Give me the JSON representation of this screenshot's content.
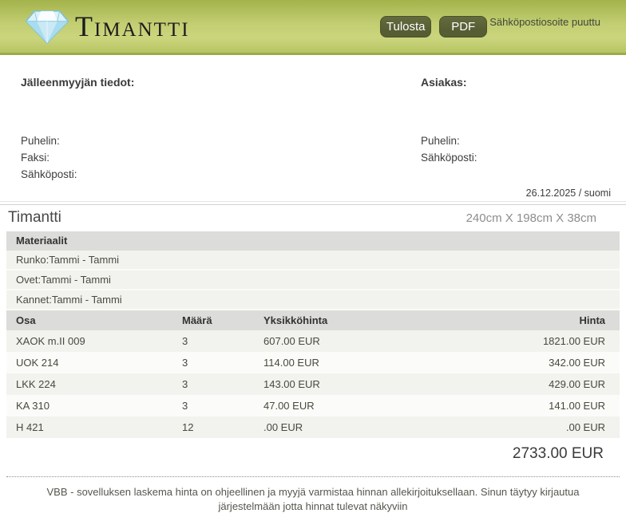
{
  "header": {
    "brand": "Timantti",
    "print_button": "Tulosta",
    "pdf_button": "PDF",
    "email_warning": "Sähköpostiosoite puuttu"
  },
  "info": {
    "dealer_heading": "Jälleenmyyjän tiedot:",
    "customer_heading": "Asiakas:",
    "dealer_fields": [
      "Puhelin:",
      "Faksi:",
      "Sähköposti:"
    ],
    "customer_fields": [
      "Puhelin:",
      "Sähköposti:"
    ],
    "date_line": "26.12.2025 / suomi"
  },
  "quote": {
    "title": "Timantti",
    "dimensions": "240cm X 198cm X 38cm",
    "materials_heading": "Materiaalit",
    "materials": [
      "Runko:Tammi - Tammi",
      "Ovet:Tammi - Tammi",
      "Kannet:Tammi - Tammi"
    ],
    "parts_table": {
      "headers": [
        "Osa",
        "Määrä",
        "Yksikköhinta",
        "Hinta"
      ],
      "rows": [
        [
          "XAOK m.II 009",
          "3",
          "607.00 EUR",
          "1821.00 EUR"
        ],
        [
          "UOK 214",
          "3",
          "114.00 EUR",
          "342.00 EUR"
        ],
        [
          "LKK 224",
          "3",
          "143.00 EUR",
          "429.00 EUR"
        ],
        [
          "KA 310",
          "3",
          "47.00 EUR",
          "141.00 EUR"
        ],
        [
          "H 421",
          "12",
          ".00 EUR",
          ".00 EUR"
        ]
      ]
    },
    "total": "2733.00 EUR"
  },
  "footer": {
    "disclaimer": "VBB - sovelluksen laskema hinta on ohjeellinen ja myyjä varmistaa hinnan allekirjoituksellaan. Sinun täytyy kirjautua järjestelmään jotta hinnat tulevat näkyviin"
  },
  "colors": {
    "header_green_top": "#a4b34c",
    "header_green_mid": "#c2ce72",
    "header_green_mid2": "#cbd57d",
    "header_green_bottom": "#b7c563",
    "header_green_border": "#9cab49",
    "button_olive": "#565d33",
    "bar_gray": "#dcdcda",
    "row_stripe": "#f2f2ee",
    "row_stripe_alt": "#fbfbf9"
  }
}
